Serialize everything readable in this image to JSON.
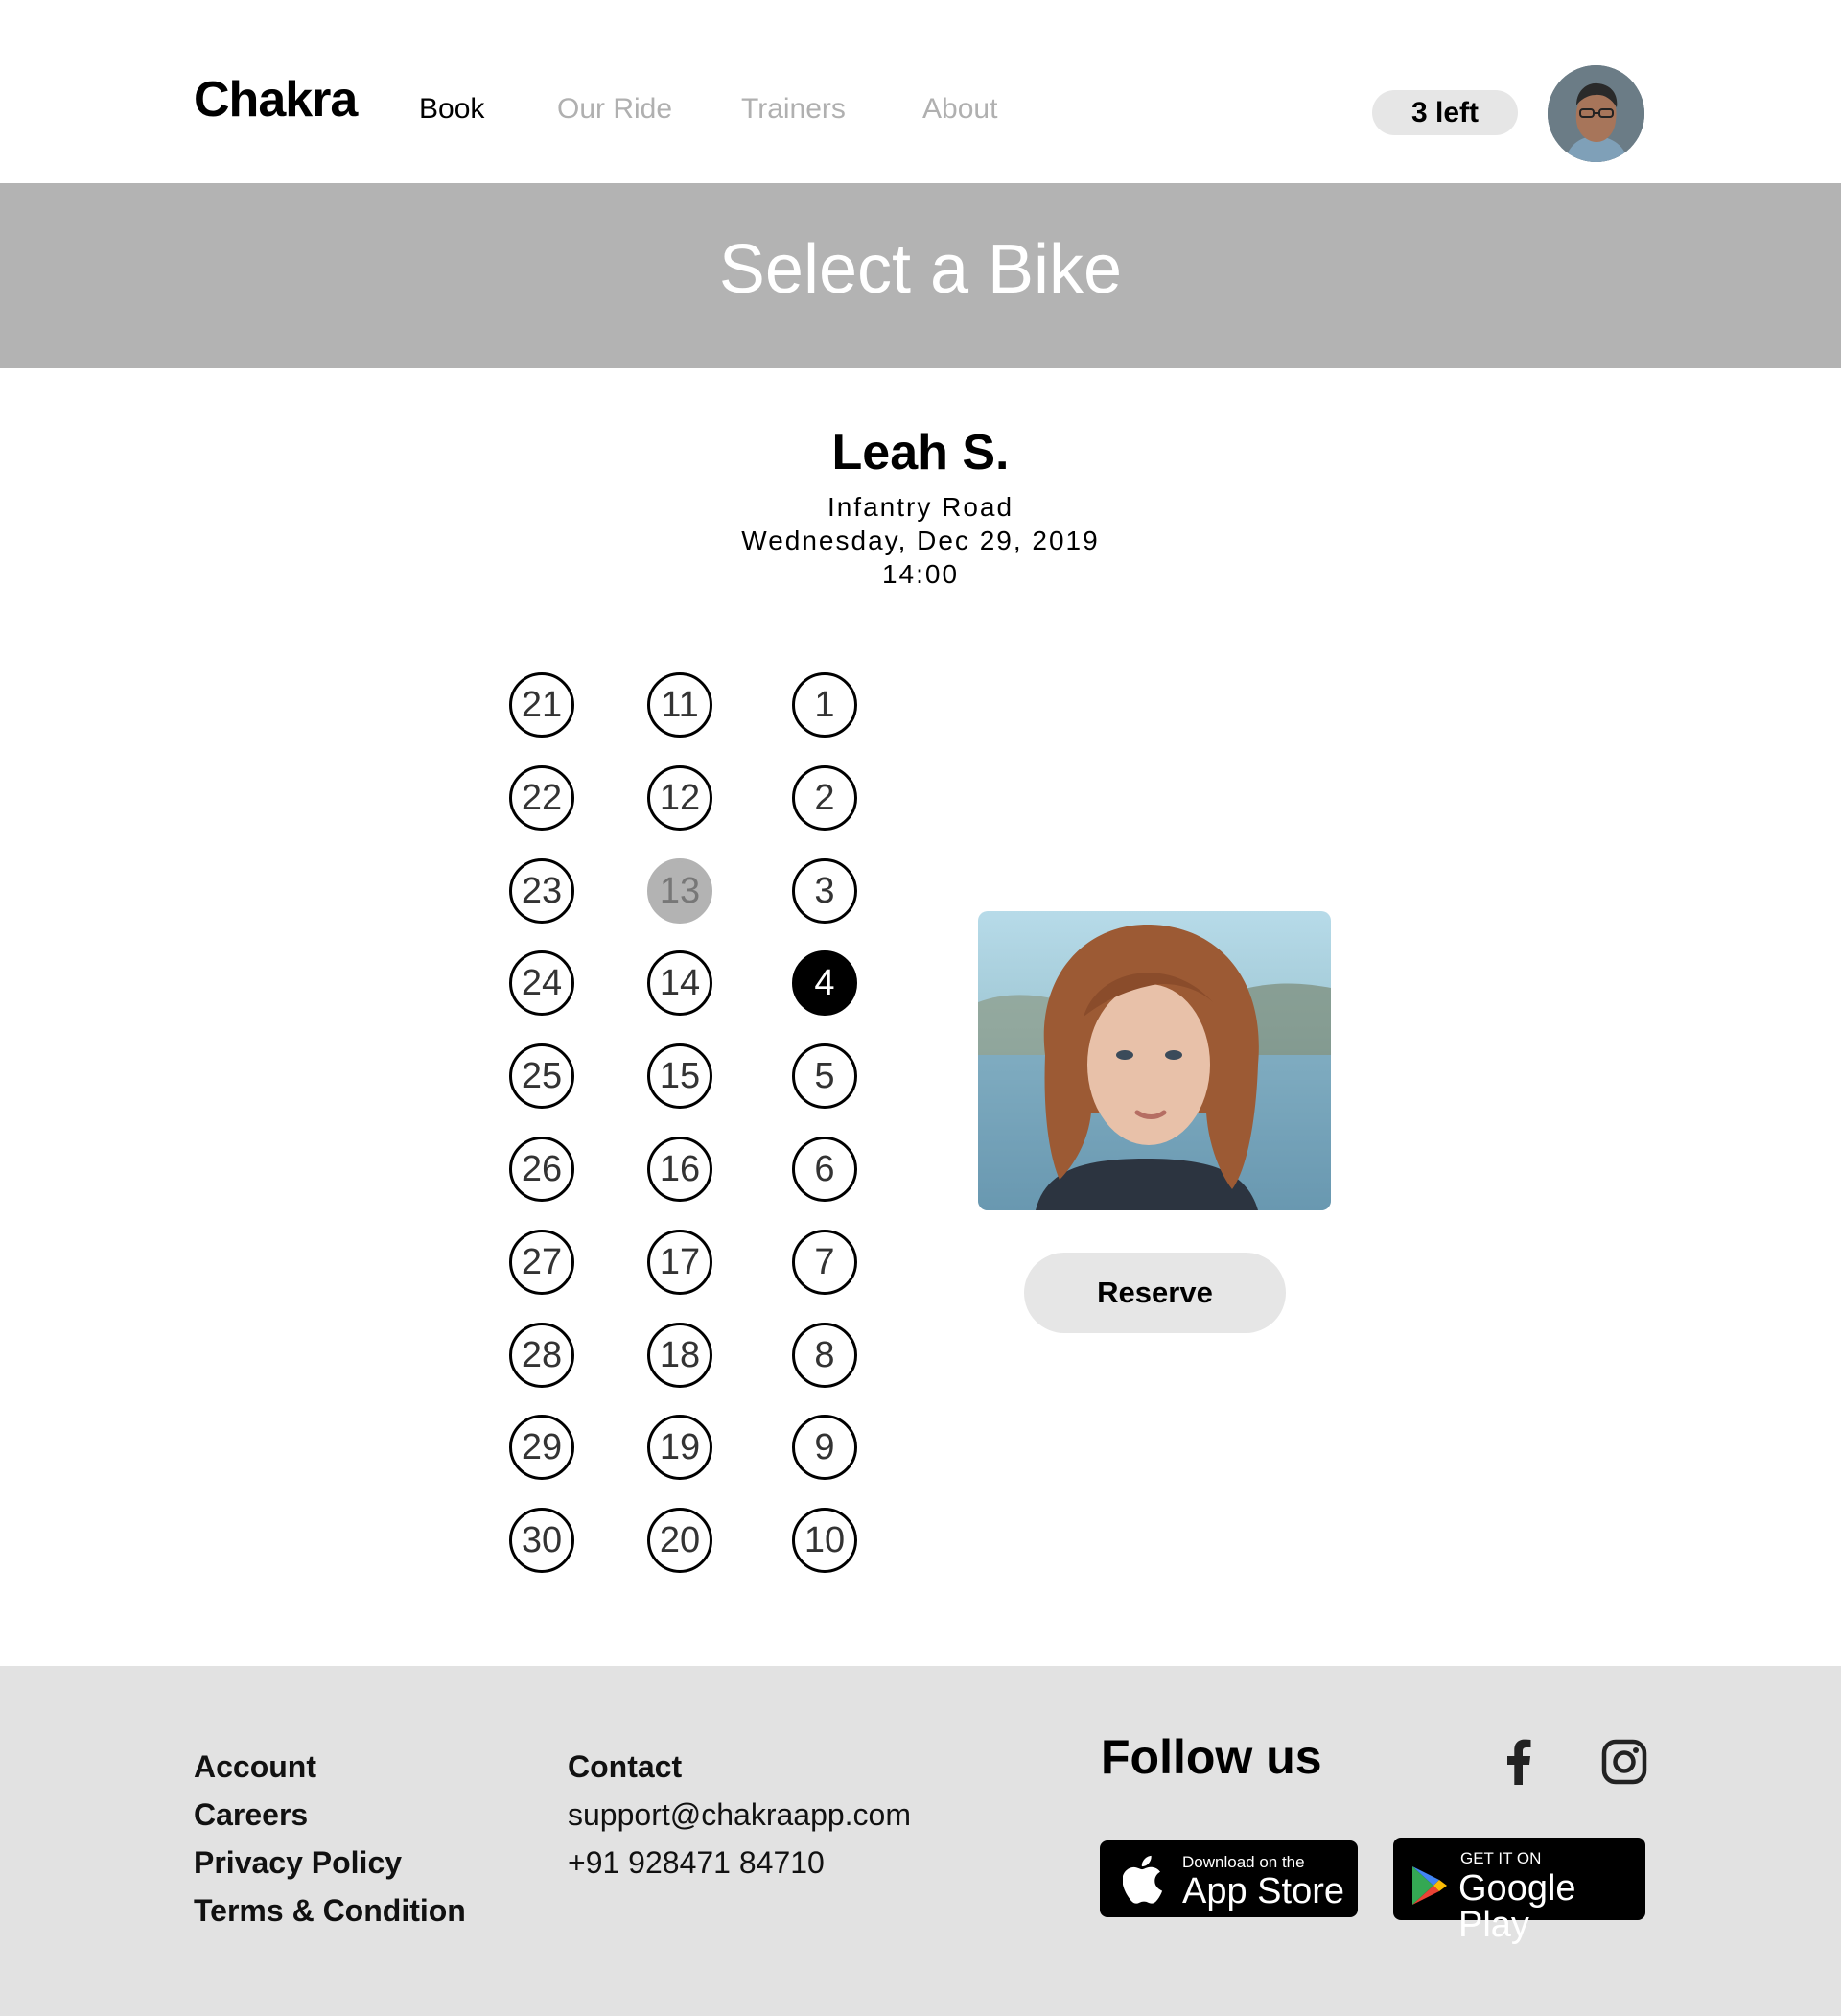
{
  "header": {
    "logo": "Chakra",
    "nav": [
      {
        "label": "Book",
        "active": true
      },
      {
        "label": "Our Ride",
        "active": false
      },
      {
        "label": "Trainers",
        "active": false
      },
      {
        "label": "About",
        "active": false
      }
    ],
    "credits": "3 left"
  },
  "banner": {
    "title": "Select a Bike"
  },
  "class_info": {
    "trainer": "Leah S.",
    "location": "Infantry Road",
    "date": "Wednesday, Dec 29, 2019",
    "time": "14:00"
  },
  "bikes": {
    "columns": [
      [
        "21",
        "22",
        "23",
        "24",
        "25",
        "26",
        "27",
        "28",
        "29",
        "30"
      ],
      [
        "11",
        "12",
        "13",
        "14",
        "15",
        "16",
        "17",
        "18",
        "19",
        "20"
      ],
      [
        "1",
        "2",
        "3",
        "4",
        "5",
        "6",
        "7",
        "8",
        "9",
        "10"
      ]
    ],
    "taken": [
      "13"
    ],
    "selected": "4"
  },
  "reserve_label": "Reserve",
  "footer": {
    "account_links": [
      "Account",
      "Careers",
      "Privacy Policy",
      "Terms & Condition"
    ],
    "contact_title": "Contact",
    "email": "support@chakraapp.com",
    "phone": "+91 928471 84710",
    "follow_title": "Follow us",
    "social_icons": [
      "facebook-icon",
      "instagram-icon"
    ],
    "app_store": {
      "small": "Download on the",
      "big": "App Store"
    },
    "google_play": {
      "small": "GET IT ON",
      "big": "Google Play"
    }
  }
}
